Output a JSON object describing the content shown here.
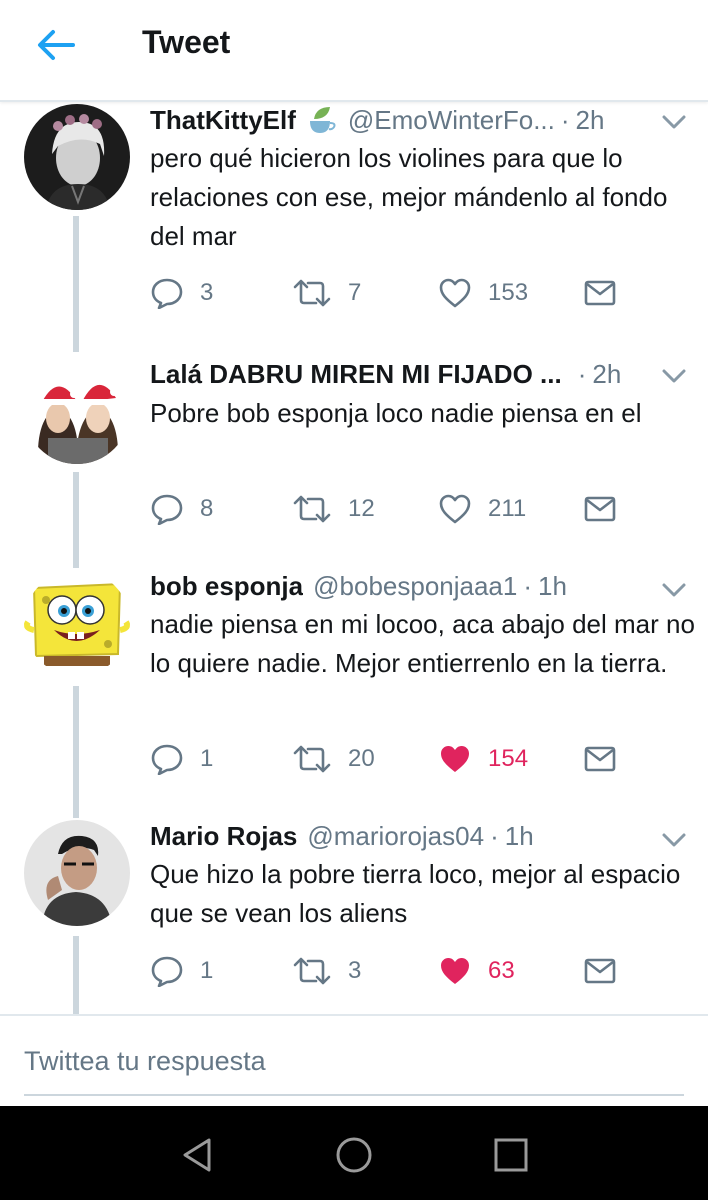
{
  "header": {
    "title": "Tweet"
  },
  "tweets": [
    {
      "name": "ThatKittyElf",
      "handle": "@EmoWinterFo...",
      "dot": "·",
      "time": "2h",
      "text": "pero qué hicieron los violines para que lo relaciones con ese, mejor mándenlo al fondo del mar",
      "replies": "3",
      "retweets": "7",
      "likes": "153",
      "liked": false,
      "name_emoji": "leaf-teacup-icon"
    },
    {
      "name": "Lalá DABRU MIREN MI FIJADO ...",
      "handle": "",
      "dot": "·",
      "time": "2h",
      "text": "Pobre bob esponja loco nadie piensa en el",
      "replies": "8",
      "retweets": "12",
      "likes": "211",
      "liked": false
    },
    {
      "name": "bob esponja",
      "handle": "@bobesponjaaa1",
      "dot": "·",
      "time": "1h",
      "text": "nadie piensa en mi locoo, aca abajo del mar no lo quiere nadie. Mejor entierrenlo en la tierra.",
      "replies": "1",
      "retweets": "20",
      "likes": "154",
      "liked": true
    },
    {
      "name": "Mario Rojas",
      "handle": "@mariorojas04",
      "dot": "·",
      "time": "1h",
      "text": "Que hizo la pobre tierra loco, mejor al espacio que se vean los aliens",
      "replies": "1",
      "retweets": "3",
      "likes": "63",
      "liked": true
    }
  ],
  "reply": {
    "placeholder": "Twittea tu respuesta"
  },
  "colors": {
    "like_active": "#e0245e",
    "accent": "#1da1f2",
    "muted": "#657786",
    "thread_line": "#ccd6dd"
  }
}
